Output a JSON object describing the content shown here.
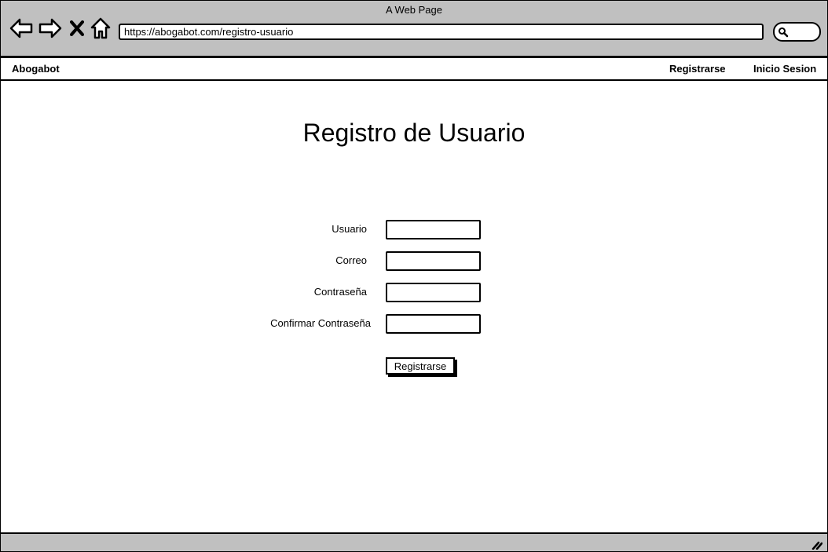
{
  "window": {
    "title": "A Web Page"
  },
  "browser": {
    "url": "https://abogabot.com/registro-usuario",
    "icons": {
      "back": "arrow-left-icon",
      "forward": "arrow-right-icon",
      "stop": "close-icon",
      "home": "home-icon",
      "search": "search-icon",
      "resize": "resize-grip-icon"
    }
  },
  "navbar": {
    "brand": "Abogabot",
    "links": {
      "register": "Registrarse",
      "login": "Inicio Sesion"
    }
  },
  "form": {
    "title": "Registro de Usuario",
    "fields": {
      "user": {
        "label": "Usuario",
        "value": ""
      },
      "email": {
        "label": "Correo",
        "value": ""
      },
      "password": {
        "label": "Contraseña",
        "value": ""
      },
      "confirm": {
        "label": "Confirmar Contraseña",
        "value": ""
      }
    },
    "submit_label": "Registrarse"
  }
}
